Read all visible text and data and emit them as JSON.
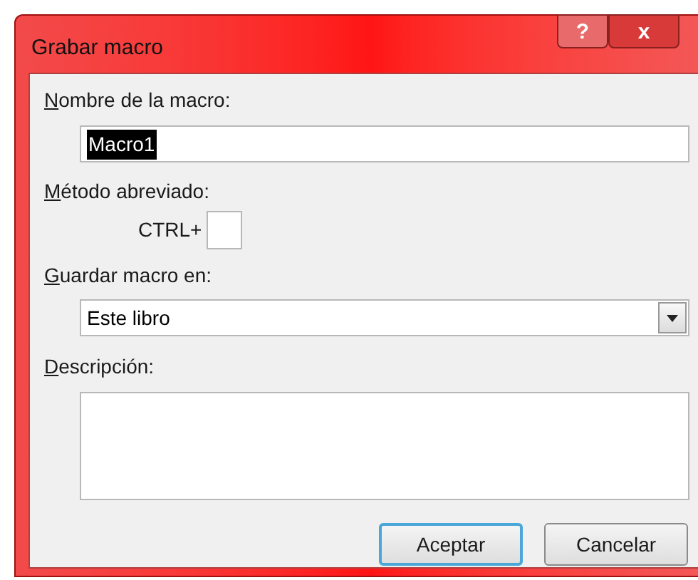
{
  "window": {
    "title": "Grabar macro",
    "title_buttons": [
      {
        "kind": "help",
        "label": "?"
      },
      {
        "kind": "close",
        "label": "x"
      }
    ]
  },
  "macro_name": {
    "label": "Nombre de la macro:",
    "value": "Macro1",
    "value_selected": true
  },
  "shortcut": {
    "label": "Método abreviado:",
    "prefix": "CTRL+"
  },
  "store_in": {
    "label": "Guardar macro en:",
    "value": "Este libro"
  },
  "description": {
    "label": "Descripción:"
  },
  "buttons": [
    {
      "label": "Aceptar",
      "default": true
    },
    {
      "label": "Cancelar",
      "default": false
    }
  ]
}
